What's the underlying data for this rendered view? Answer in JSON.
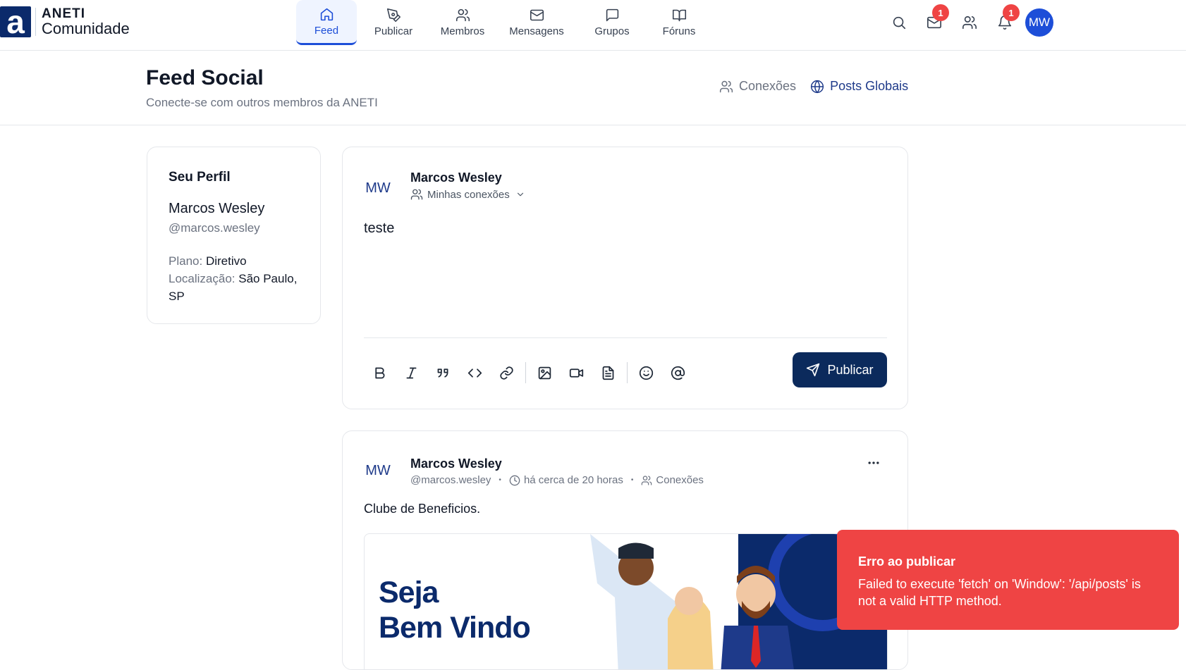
{
  "brand": {
    "line1": "ANETI",
    "line2": "Comunidade",
    "mark": "a"
  },
  "nav": [
    {
      "label": "Feed",
      "icon": "home-icon",
      "active": true
    },
    {
      "label": "Publicar",
      "icon": "pen-icon"
    },
    {
      "label": "Membros",
      "icon": "users-icon"
    },
    {
      "label": "Mensagens",
      "icon": "mail-icon"
    },
    {
      "label": "Grupos",
      "icon": "chat-icon"
    },
    {
      "label": "Fóruns",
      "icon": "book-icon"
    }
  ],
  "header_right": {
    "messages_badge": "1",
    "notifications_badge": "1",
    "avatar": "MW"
  },
  "page": {
    "title": "Feed Social",
    "subtitle": "Conecte-se com outros membros da ANETI"
  },
  "feed_toggle": {
    "connections": "Conexões",
    "global": "Posts Globais"
  },
  "profile": {
    "title": "Seu Perfil",
    "name": "Marcos Wesley",
    "handle": "@marcos.wesley",
    "plan_label": "Plano:",
    "plan_value": "Diretivo",
    "location_label": "Localização:",
    "location_value": "São Paulo, SP"
  },
  "composer": {
    "avatar": "MW",
    "name": "Marcos Wesley",
    "visibility": "Minhas conexões",
    "text": "teste",
    "publish_label": "Publicar"
  },
  "post": {
    "avatar": "MW",
    "name": "Marcos Wesley",
    "handle": "@marcos.wesley",
    "time": "há cerca de 20 horas",
    "visibility": "Conexões",
    "text": "Clube de Beneficios.",
    "image_text_1": "Seja",
    "image_text_2": "Bem Vindo"
  },
  "toast": {
    "title": "Erro ao publicar",
    "message": "Failed to execute 'fetch' on 'Window': '/api/posts' is not a valid HTTP method."
  },
  "colors": {
    "accent": "#1d4ed8",
    "navy": "#0b2a5c",
    "error": "#ef4444"
  }
}
